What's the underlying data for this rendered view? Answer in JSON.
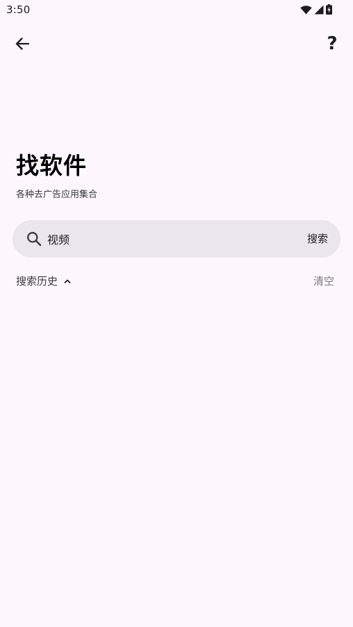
{
  "status_bar": {
    "time": "3:50",
    "icons": [
      "wifi-icon",
      "signal-icon",
      "battery-charging-icon"
    ]
  },
  "top_bar": {
    "back_icon": "arrow-left-icon",
    "help_label": "?"
  },
  "header": {
    "title": "找软件",
    "subtitle": "各种去广告应用集合"
  },
  "search": {
    "value": "视频",
    "button_label": "搜索",
    "icon": "search-icon"
  },
  "history": {
    "label": "搜索历史",
    "toggle_icon": "chevron-up-icon",
    "clear_label": "清空"
  },
  "colors": {
    "background": "#fdf7fd",
    "search_fill": "#ebe6ee",
    "text_primary": "#1c1b1f",
    "text_muted": "#7c7a80"
  }
}
